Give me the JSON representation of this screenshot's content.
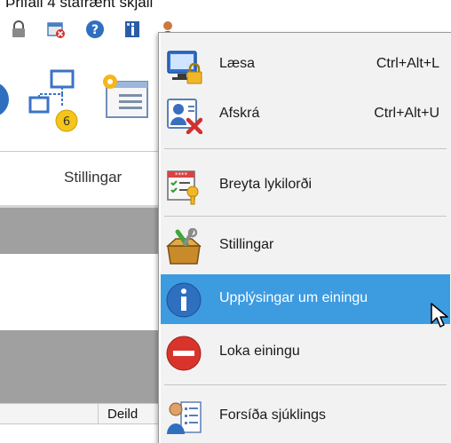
{
  "app": {
    "top_text": "Þrifali 4 stafrænt skjali",
    "ribbon_label": "Stillingar",
    "notification_count": "6",
    "grid_column": "Deild"
  },
  "menu": {
    "items": [
      {
        "label": "Læsa",
        "shortcut": "Ctrl+Alt+L",
        "icon": "lock-screen-icon"
      },
      {
        "label": "Afskrá",
        "shortcut": "Ctrl+Alt+U",
        "icon": "logout-user-icon"
      },
      {
        "label": "Breyta lykilorði",
        "shortcut": "",
        "icon": "change-password-icon"
      },
      {
        "label": "Stillingar",
        "shortcut": "",
        "icon": "toolbox-icon"
      },
      {
        "label": "Upplýsingar um einingu",
        "shortcut": "",
        "icon": "info-icon"
      },
      {
        "label": "Loka einingu",
        "shortcut": "",
        "icon": "close-unit-icon"
      },
      {
        "label": "Forsíða sjúklings",
        "shortcut": "",
        "icon": "patient-front-page-icon"
      }
    ],
    "highlight_color": "#3d9be0"
  }
}
